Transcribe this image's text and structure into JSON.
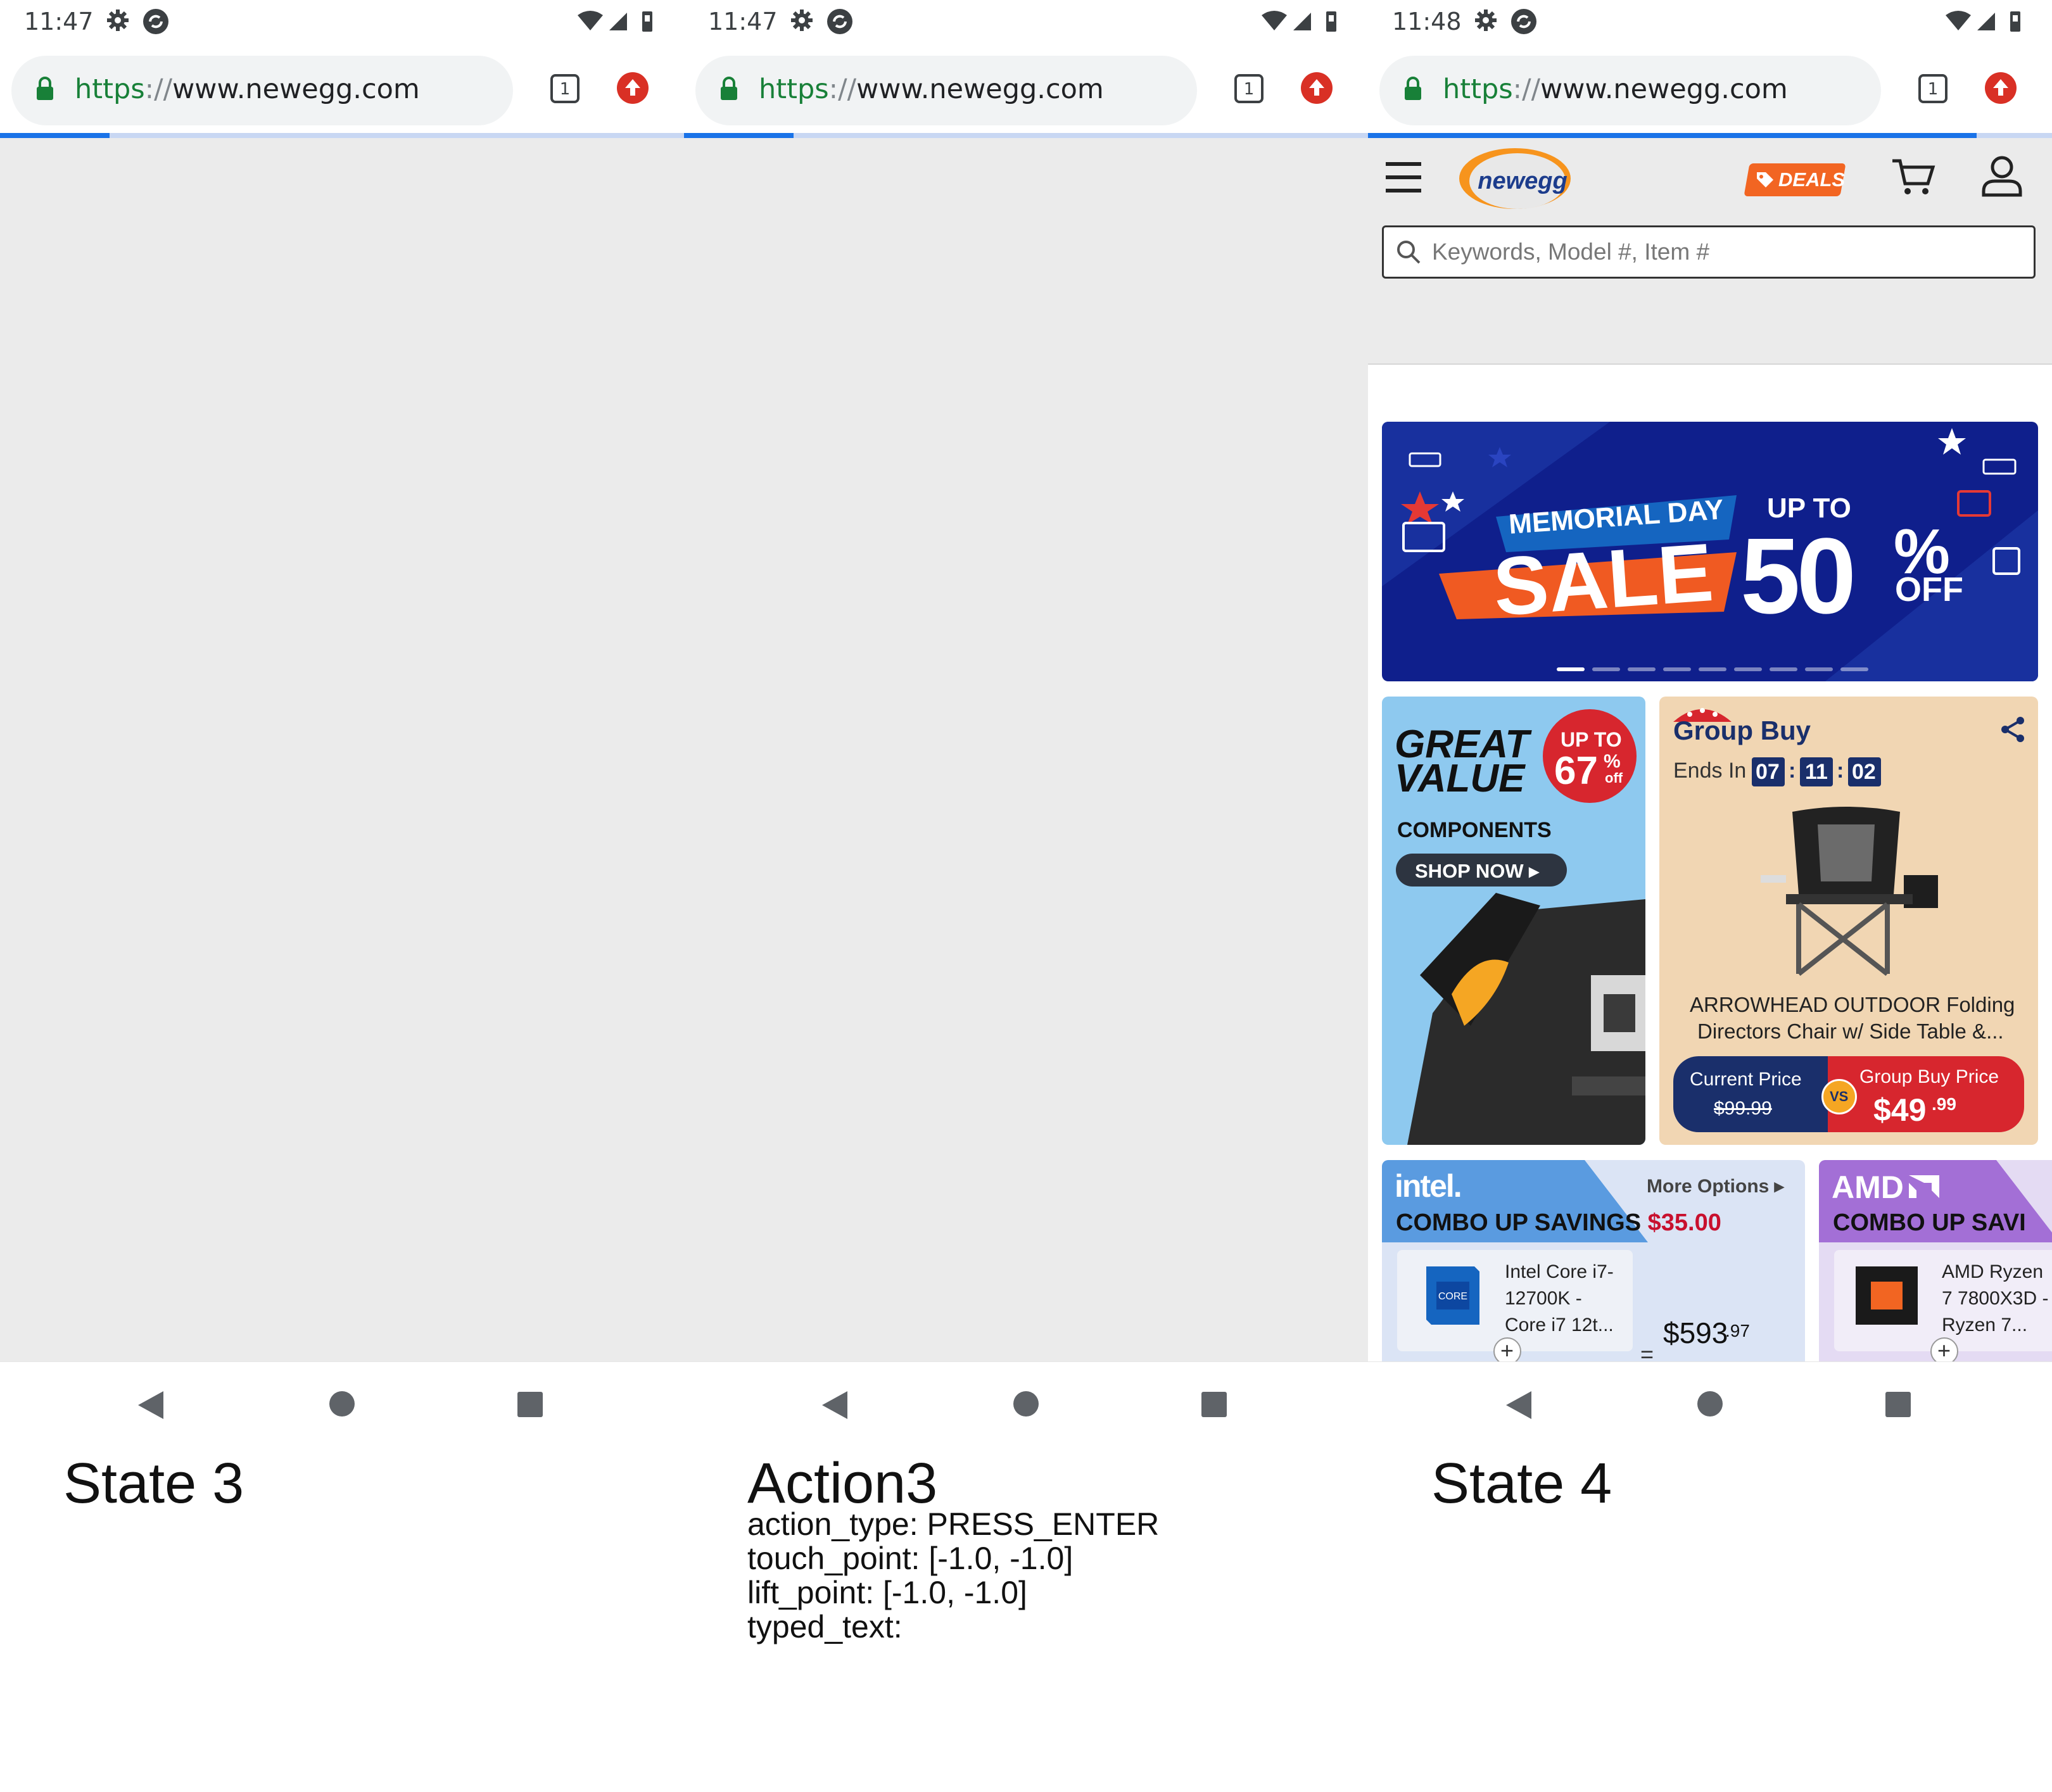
{
  "panels": [
    {
      "status": {
        "time": "11:47"
      },
      "browser": {
        "url_scheme": "https",
        "url_sep": "://",
        "url_host": "www.newegg.com",
        "tab_count": "1"
      },
      "load_progress": 0.16,
      "caption": "State 3"
    },
    {
      "status": {
        "time": "11:47"
      },
      "browser": {
        "url_scheme": "https",
        "url_sep": "://",
        "url_host": "www.newegg.com",
        "tab_count": "1"
      },
      "load_progress": 0.16,
      "caption": "Action3",
      "action": {
        "type_line": "action_type: PRESS_ENTER",
        "touch_line": "touch_point: [-1.0, -1.0]",
        "lift_line": "lift_point: [-1.0, -1.0]",
        "typed_line": "typed_text:"
      }
    },
    {
      "status": {
        "time": "11:48"
      },
      "browser": {
        "url_scheme": "https",
        "url_sep": "://",
        "url_host": "www.newegg.com",
        "tab_count": "1"
      },
      "load_progress": 0.89,
      "caption": "State 4",
      "newegg": {
        "logo_text": "newegg",
        "deals_label": "DEALS",
        "search_placeholder": "Keywords, Model #, Item #",
        "banner": {
          "tag": "MEMORIAL DAY",
          "headline": "SALE",
          "up_to": "UP TO",
          "percent": "50",
          "percent_sign": "%",
          "off": "OFF",
          "dots": 9,
          "active_dot": 1
        },
        "great_value": {
          "line1": "GREAT",
          "line2": "VALUE",
          "badge_up_to": "UP TO",
          "badge_pct": "67",
          "badge_sign": "%",
          "badge_off": "off",
          "category": "COMPONENTS",
          "cta": "SHOP NOW ▸"
        },
        "group_buy": {
          "title": "Group Buy",
          "ends_in": "Ends In",
          "hh": "07",
          "mm": "11",
          "ss": "02",
          "product_line1": "ARROWHEAD OUTDOOR Folding",
          "product_line2": "Directors Chair w/ Side Table &...",
          "current_label": "Current Price",
          "current_price": "$99.99",
          "vs": "VS",
          "group_label": "Group Buy Price",
          "group_price_main": "$49",
          "group_price_cents": ".99"
        },
        "intel_card": {
          "brand": "intel.",
          "more": "More Options ▸",
          "title": "COMBO UP SAVINGS",
          "savings": "$35.00",
          "product_line1": "Intel Core i7-",
          "product_line2": "12700K -",
          "product_line3": "Core i7 12t...",
          "price_main": "$593",
          "price_cents": ".97",
          "plus": "+",
          "equals": "="
        },
        "amd_card": {
          "brand": "AMD",
          "title": "COMBO UP SAVI",
          "product_line1": "AMD Ryzen",
          "product_line2": "7 7800X3D -",
          "product_line3": "Ryzen 7...",
          "plus": "+"
        }
      }
    }
  ],
  "colors": {
    "accent_blue": "#1a73e8",
    "newegg_orange": "#f26522",
    "newegg_navy": "#0f1f8c",
    "price_red": "#c8102e"
  }
}
